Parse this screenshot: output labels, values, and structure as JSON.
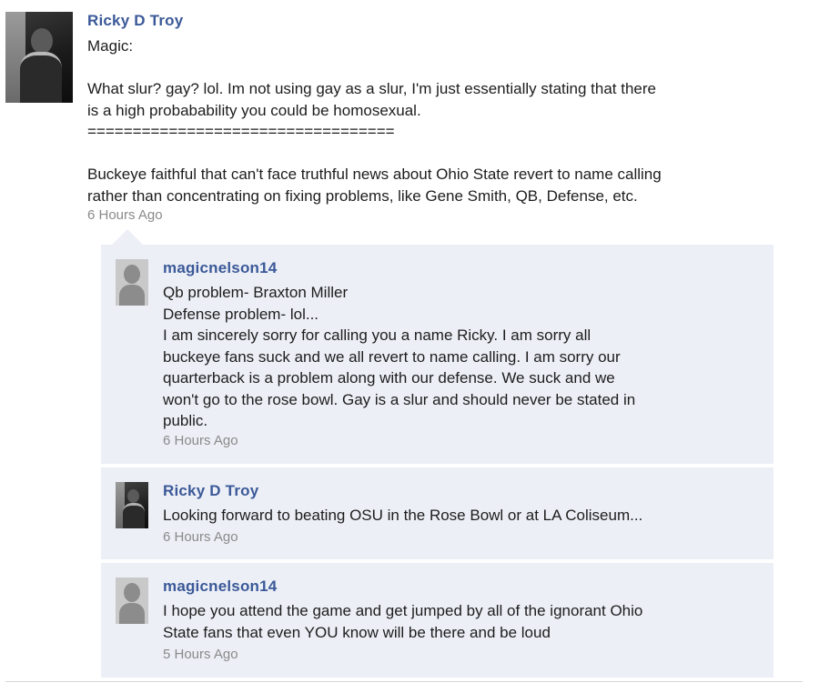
{
  "main_post": {
    "author": "Ricky D Troy",
    "text": "Magic:\n\nWhat slur? gay? lol. Im not using gay as a slur, I'm just essentially stating that there\nis a high probabability you could be homosexual.\n==================================\n\nBuckeye faithful that can't face truthful news about Ohio State revert to name calling\nrather than concentrating on fixing problems, like Gene Smith, QB, Defense, etc.",
    "time": "6 Hours Ago",
    "avatar_icon": "profile-photo"
  },
  "replies": [
    {
      "author": "magicnelson14",
      "text": "Qb problem- Braxton Miller\nDefense problem- lol...\nI am sincerely sorry for calling you a name Ricky. I am sorry all\nbuckeye fans suck and we all revert to name calling. I am sorry our\nquarterback is a problem along with our defense. We suck and we\nwon't go to the rose bowl. Gay is a slur and should never be stated in\npublic.",
      "time": "6 Hours Ago",
      "avatar_icon": "default-avatar"
    },
    {
      "author": "Ricky D Troy",
      "text": "Looking forward to beating OSU in the Rose Bowl or at LA Coliseum...",
      "time": "6 Hours Ago",
      "avatar_icon": "profile-photo"
    },
    {
      "author": "magicnelson14",
      "text": "I hope you attend the game and get jumped by all of the ignorant Ohio\nState fans that even YOU know will be there and be loud",
      "time": "5 Hours Ago",
      "avatar_icon": "default-avatar"
    }
  ],
  "colors": {
    "author_link": "#3b5998",
    "reply_background": "#eceff6",
    "timestamp": "#8a8a8a"
  }
}
